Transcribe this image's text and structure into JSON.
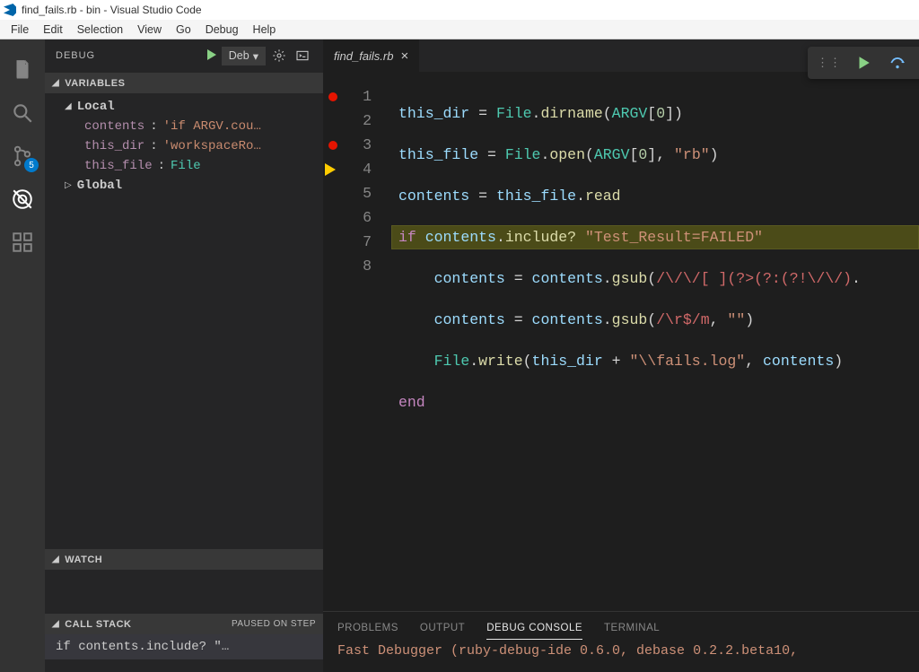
{
  "title": "find_fails.rb - bin - Visual Studio Code",
  "menu": [
    "File",
    "Edit",
    "Selection",
    "View",
    "Go",
    "Debug",
    "Help"
  ],
  "activity_badge": "5",
  "sidebar": {
    "label": "DEBUG",
    "config": "Deb",
    "sections": {
      "variables": "VARIABLES",
      "local": "Local",
      "global": "Global",
      "watch": "WATCH",
      "callstack": "CALL STACK",
      "paused": "PAUSED ON STEP"
    },
    "vars": {
      "contents_name": "contents",
      "contents_val": "'if ARGV.cou…",
      "thisdir_name": "this_dir",
      "thisdir_val": "'workspaceRo…",
      "thisfile_name": "this_file",
      "thisfile_val": "File"
    },
    "callstack_item": "if contents.include? \"…"
  },
  "tab": {
    "name": "find_fails.rb"
  },
  "gutter": [
    "1",
    "2",
    "3",
    "4",
    "5",
    "6",
    "7",
    "8"
  ],
  "panel": {
    "tabs": {
      "problems": "PROBLEMS",
      "output": "OUTPUT",
      "debug": "DEBUG CONSOLE",
      "terminal": "TERMINAL"
    },
    "line": "Fast Debugger (ruby-debug-ide 0.6.0, debase 0.2.2.beta10,"
  }
}
